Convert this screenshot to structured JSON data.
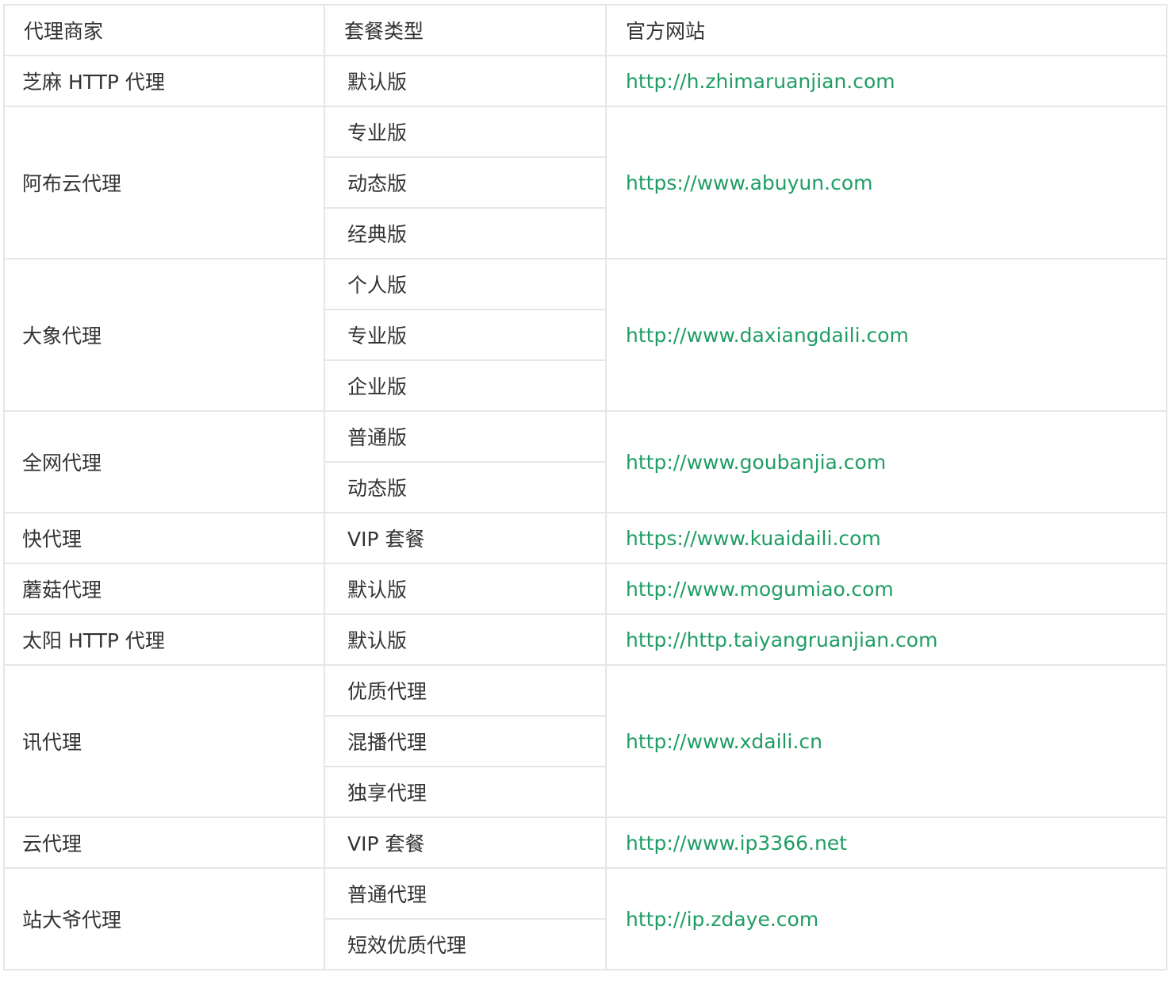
{
  "header": {
    "vendor": "代理商家",
    "package": "套餐类型",
    "website": "官方网站"
  },
  "colors": {
    "link": "#1f9d64",
    "text": "#333333",
    "border": "#e6e6e6"
  },
  "rows": [
    {
      "vendor": "芝麻 HTTP 代理",
      "packages": [
        "默认版"
      ],
      "website": "http://h.zhimaruanjian.com"
    },
    {
      "vendor": "阿布云代理",
      "packages": [
        "专业版",
        "动态版",
        "经典版"
      ],
      "website": "https://www.abuyun.com"
    },
    {
      "vendor": "大象代理",
      "packages": [
        "个人版",
        "专业版",
        "企业版"
      ],
      "website": "http://www.daxiangdaili.com"
    },
    {
      "vendor": "全网代理",
      "packages": [
        "普通版",
        "动态版"
      ],
      "website": "http://www.goubanjia.com"
    },
    {
      "vendor": "快代理",
      "packages": [
        "VIP 套餐"
      ],
      "website": "https://www.kuaidaili.com"
    },
    {
      "vendor": "蘑菇代理",
      "packages": [
        "默认版"
      ],
      "website": "http://www.mogumiao.com"
    },
    {
      "vendor": "太阳 HTTP 代理",
      "packages": [
        "默认版"
      ],
      "website": "http://http.taiyangruanjian.com"
    },
    {
      "vendor": "讯代理",
      "packages": [
        "优质代理",
        "混播代理",
        "独享代理"
      ],
      "website": "http://www.xdaili.cn"
    },
    {
      "vendor": "云代理",
      "packages": [
        "VIP 套餐"
      ],
      "website": "http://www.ip3366.net"
    },
    {
      "vendor": "站大爷代理",
      "packages": [
        "普通代理",
        "短效优质代理"
      ],
      "website": "http://ip.zdaye.com"
    }
  ]
}
